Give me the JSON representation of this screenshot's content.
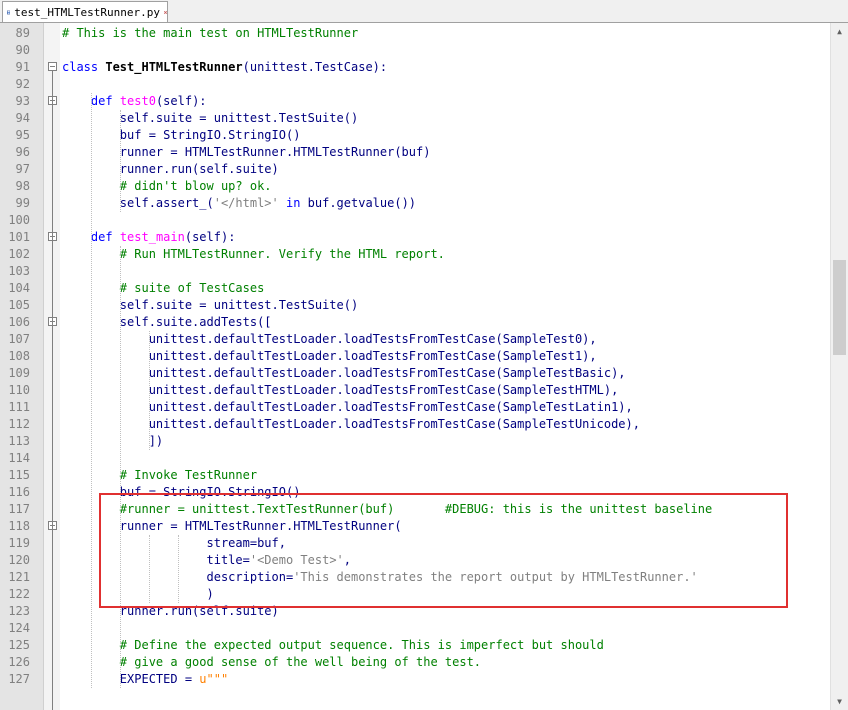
{
  "tab": {
    "label": "test_HTMLTestRunner.py"
  },
  "lines": [
    {
      "n": "89",
      "html": "<span class=\"cm\"># This is the main test on HTMLTestRunner</span>"
    },
    {
      "n": "90",
      "html": ""
    },
    {
      "n": "91",
      "html": "<span class=\"kw\">class</span> <span class=\"cls\">Test_HTMLTestRunner</span>(unittest.TestCase):",
      "fold": true
    },
    {
      "n": "92",
      "html": ""
    },
    {
      "n": "93",
      "html": "    <span class=\"kw\">def</span> <span class=\"fn\">test0</span>(self):",
      "fold": true
    },
    {
      "n": "94",
      "html": "        self.suite = unittest.TestSuite()"
    },
    {
      "n": "95",
      "html": "        buf = StringIO.StringIO()"
    },
    {
      "n": "96",
      "html": "        runner = HTMLTestRunner.HTMLTestRunner(buf)"
    },
    {
      "n": "97",
      "html": "        runner.run(self.suite)"
    },
    {
      "n": "98",
      "html": "        <span class=\"cm\"># didn't blow up? ok.</span>"
    },
    {
      "n": "99",
      "html": "        self.assert_(<span class=\"str\">'&lt;/html&gt;'</span> <span class=\"kw\">in</span> buf.getvalue())"
    },
    {
      "n": "100",
      "html": ""
    },
    {
      "n": "101",
      "html": "    <span class=\"kw\">def</span> <span class=\"fn\">test_main</span>(self):",
      "fold": true
    },
    {
      "n": "102",
      "html": "        <span class=\"cm\"># Run HTMLTestRunner. Verify the HTML report.</span>"
    },
    {
      "n": "103",
      "html": ""
    },
    {
      "n": "104",
      "html": "        <span class=\"cm\"># suite of TestCases</span>"
    },
    {
      "n": "105",
      "html": "        self.suite = unittest.TestSuite()"
    },
    {
      "n": "106",
      "html": "        self.suite.addTests([",
      "fold": true
    },
    {
      "n": "107",
      "html": "            unittest.defaultTestLoader.loadTestsFromTestCase(SampleTest0),"
    },
    {
      "n": "108",
      "html": "            unittest.defaultTestLoader.loadTestsFromTestCase(SampleTest1),"
    },
    {
      "n": "109",
      "html": "            unittest.defaultTestLoader.loadTestsFromTestCase(SampleTestBasic),"
    },
    {
      "n": "110",
      "html": "            unittest.defaultTestLoader.loadTestsFromTestCase(SampleTestHTML),"
    },
    {
      "n": "111",
      "html": "            unittest.defaultTestLoader.loadTestsFromTestCase(SampleTestLatin1),"
    },
    {
      "n": "112",
      "html": "            unittest.defaultTestLoader.loadTestsFromTestCase(SampleTestUnicode),"
    },
    {
      "n": "113",
      "html": "            ])"
    },
    {
      "n": "114",
      "html": ""
    },
    {
      "n": "115",
      "html": "        <span class=\"cm\"># Invoke TestRunner</span>"
    },
    {
      "n": "116",
      "html": "        buf = StringIO.StringIO()"
    },
    {
      "n": "117",
      "html": "        <span class=\"cm\">#runner = unittest.TextTestRunner(buf)       #DEBUG: this is the unittest baseline</span>"
    },
    {
      "n": "118",
      "html": "        runner = HTMLTestRunner.HTMLTestRunner(",
      "fold": true
    },
    {
      "n": "119",
      "html": "                    stream=buf,"
    },
    {
      "n": "120",
      "html": "                    title=<span class=\"str\">'&lt;Demo Test&gt;'</span>,"
    },
    {
      "n": "121",
      "html": "                    description=<span class=\"str\">'This demonstrates the report output by HTMLTestRunner.'</span>"
    },
    {
      "n": "122",
      "html": "                    )"
    },
    {
      "n": "123",
      "html": "        runner.run(self.suite)"
    },
    {
      "n": "124",
      "html": ""
    },
    {
      "n": "125",
      "html": "        <span class=\"cm\"># Define the expected output sequence. This is imperfect but should</span>"
    },
    {
      "n": "126",
      "html": "        <span class=\"cm\"># give a good sense of the well being of the test.</span>"
    },
    {
      "n": "127",
      "html": "        EXPECTED = <span class=\"u\">u\"\"\"</span>"
    }
  ]
}
